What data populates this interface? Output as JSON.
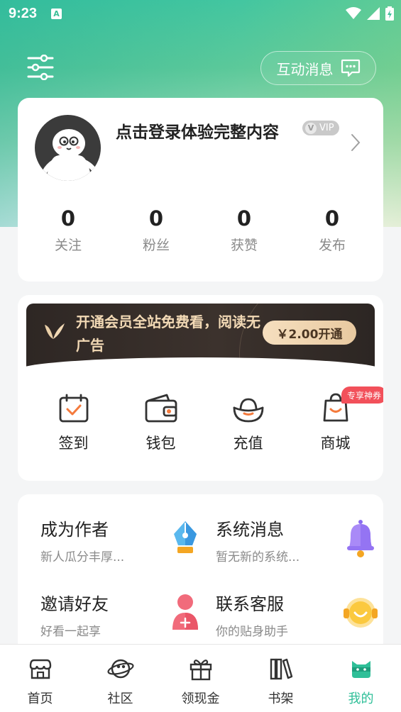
{
  "status_bar": {
    "time": "9:23",
    "notif_letter": "A"
  },
  "header": {
    "messages_label": "互动消息"
  },
  "profile": {
    "login_prompt": "点击登录体验完整内容",
    "vip_badge": "VIP",
    "stats": [
      {
        "value": "0",
        "label": "关注"
      },
      {
        "value": "0",
        "label": "粉丝"
      },
      {
        "value": "0",
        "label": "获赞"
      },
      {
        "value": "0",
        "label": "发布"
      }
    ]
  },
  "vip_banner": {
    "text": "开通会员全站免费看，阅读无广告",
    "button": "￥2.00开通"
  },
  "quick_actions": [
    {
      "label": "签到",
      "icon": "calendar-check-icon"
    },
    {
      "label": "钱包",
      "icon": "wallet-icon"
    },
    {
      "label": "充值",
      "icon": "gold-ingot-icon"
    },
    {
      "label": "商城",
      "icon": "shopping-bag-icon",
      "badge": "专享神券"
    }
  ],
  "menu": [
    {
      "title": "成为作者",
      "subtitle": "新人瓜分丰厚...",
      "icon": "pen-nib-icon"
    },
    {
      "title": "系统消息",
      "subtitle": "暂无新的系统...",
      "icon": "bell-icon"
    },
    {
      "title": "邀请好友",
      "subtitle": "好看一起享",
      "icon": "person-add-icon"
    },
    {
      "title": "联系客服",
      "subtitle": "你的贴身助手",
      "icon": "headset-smile-icon"
    }
  ],
  "tabs": [
    {
      "label": "首页",
      "icon": "store-icon"
    },
    {
      "label": "社区",
      "icon": "planet-icon"
    },
    {
      "label": "领现金",
      "icon": "gift-icon"
    },
    {
      "label": "书架",
      "icon": "books-icon"
    },
    {
      "label": "我的",
      "icon": "cat-face-icon",
      "active": true
    }
  ],
  "colors": {
    "accent": "#2fbf98",
    "vip_gold": "#f2d9b5",
    "badge_red": "#f2505a"
  }
}
